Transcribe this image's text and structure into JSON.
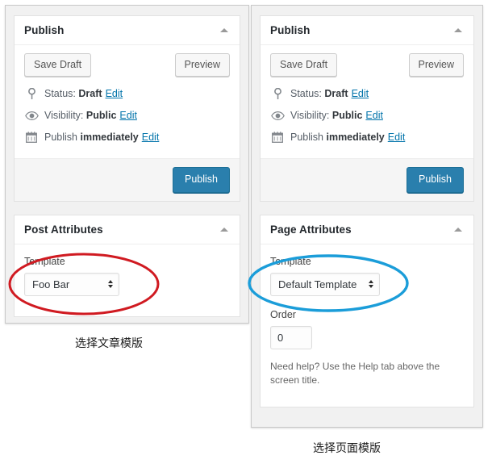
{
  "colors": {
    "primary_button": "#2a7fad",
    "link": "#0073aa",
    "annotation_red": "#d01a21",
    "annotation_blue": "#1b9dd9",
    "panel_background": "#f1f1f1"
  },
  "post_screenshot": {
    "publish_box": {
      "title": "Publish",
      "toggle_icon": "triangle-up-icon",
      "save_draft_label": "Save Draft",
      "preview_label": "Preview",
      "misc_items": [
        {
          "icon": "post-status-pin-icon",
          "prefix": "Status:",
          "value": "Draft",
          "suffix": "",
          "edit_label": "Edit"
        },
        {
          "icon": "visibility-eye-icon",
          "prefix": "Visibility:",
          "value": "Public",
          "suffix": "",
          "edit_label": "Edit"
        },
        {
          "icon": "calendar-icon",
          "prefix": "Publish",
          "value": "immediately",
          "suffix": "",
          "edit_label": "Edit"
        }
      ],
      "publish_label": "Publish"
    },
    "attributes_box": {
      "title": "Post Attributes",
      "toggle_icon": "triangle-up-icon",
      "template_label": "Template",
      "template_value": "Foo Bar"
    }
  },
  "page_screenshot": {
    "publish_box": {
      "title": "Publish",
      "toggle_icon": "triangle-up-icon",
      "save_draft_label": "Save Draft",
      "preview_label": "Preview",
      "misc_items": [
        {
          "icon": "post-status-pin-icon",
          "prefix": "Status:",
          "value": "Draft",
          "suffix": "",
          "edit_label": "Edit"
        },
        {
          "icon": "visibility-eye-icon",
          "prefix": "Visibility:",
          "value": "Public",
          "suffix": "",
          "edit_label": "Edit"
        },
        {
          "icon": "calendar-icon",
          "prefix": "Publish",
          "value": "immediately",
          "suffix": "",
          "edit_label": "Edit"
        }
      ],
      "publish_label": "Publish"
    },
    "attributes_box": {
      "title": "Page Attributes",
      "toggle_icon": "triangle-up-icon",
      "template_label": "Template",
      "template_value": "Default Template",
      "order_label": "Order",
      "order_value": "0",
      "help_text": "Need help? Use the Help tab above the screen title."
    }
  },
  "captions": {
    "post": "选择文章模版",
    "page": "选择页面模版"
  }
}
